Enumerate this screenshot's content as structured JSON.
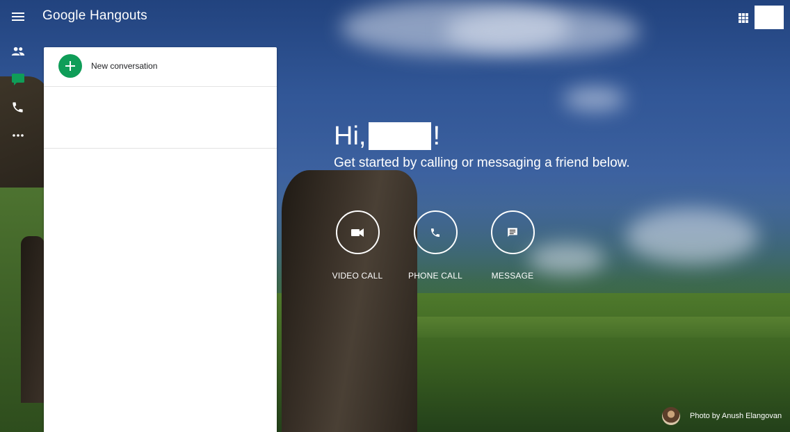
{
  "app": {
    "title": "Google Hangouts"
  },
  "topbar": {
    "menu_icon": "hamburger-menu-icon",
    "apps_icon": "apps-grid-icon"
  },
  "rail": {
    "items": [
      {
        "name": "contacts",
        "icon": "people-icon"
      },
      {
        "name": "conversations",
        "icon": "chat-icon",
        "active": true
      },
      {
        "name": "phone-calls",
        "icon": "phone-icon"
      },
      {
        "name": "more",
        "icon": "more-horizontal-icon"
      }
    ],
    "active_color": "#0f9d58"
  },
  "panel": {
    "new_conversation_label": "New conversation",
    "accent": "#0f9d58"
  },
  "greeting": {
    "hi": "Hi,",
    "exclaim": "!",
    "subtitle": "Get started by calling or messaging a friend below."
  },
  "actions": [
    {
      "label": "VIDEO CALL",
      "icon": "videocam-icon"
    },
    {
      "label": "PHONE CALL",
      "icon": "phone-icon"
    },
    {
      "label": "MESSAGE",
      "icon": "message-icon"
    }
  ],
  "credit": {
    "text": "Photo by Anush Elangovan"
  }
}
